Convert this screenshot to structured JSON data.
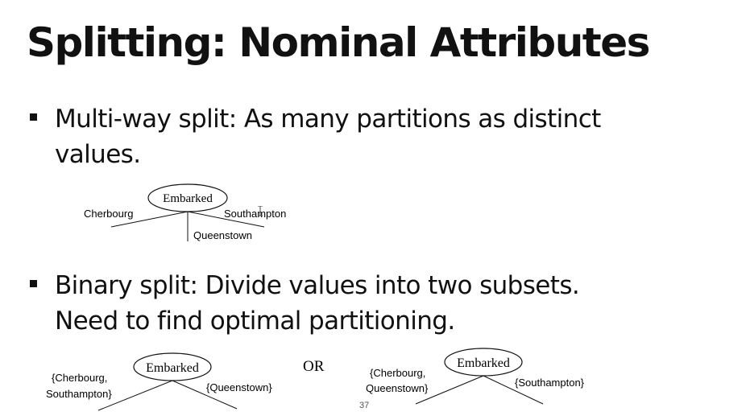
{
  "slide": {
    "title": "Splitting: Nominal Attributes",
    "bullets": [
      {
        "line1": "Multi-way split: As many partitions as distinct",
        "line2": "values."
      },
      {
        "line1": "Binary split:  Divide values into two subsets.",
        "line2": "Need to find optimal partitioning."
      }
    ],
    "page_number": "37"
  },
  "diagrams": {
    "multiway": {
      "node": "Embarked",
      "branches": [
        "Cherbourg",
        "Queenstown",
        "Southampton"
      ]
    },
    "binary_left": {
      "node": "Embarked",
      "left_line1": "{Cherbourg,",
      "left_line2": "Southampton}",
      "right": "{Queenstown}"
    },
    "or_label": "OR",
    "binary_right": {
      "node": "Embarked",
      "left_line1": "{Cherbourg,",
      "left_line2": "Queenstown}",
      "right": "{Southampton}"
    }
  }
}
